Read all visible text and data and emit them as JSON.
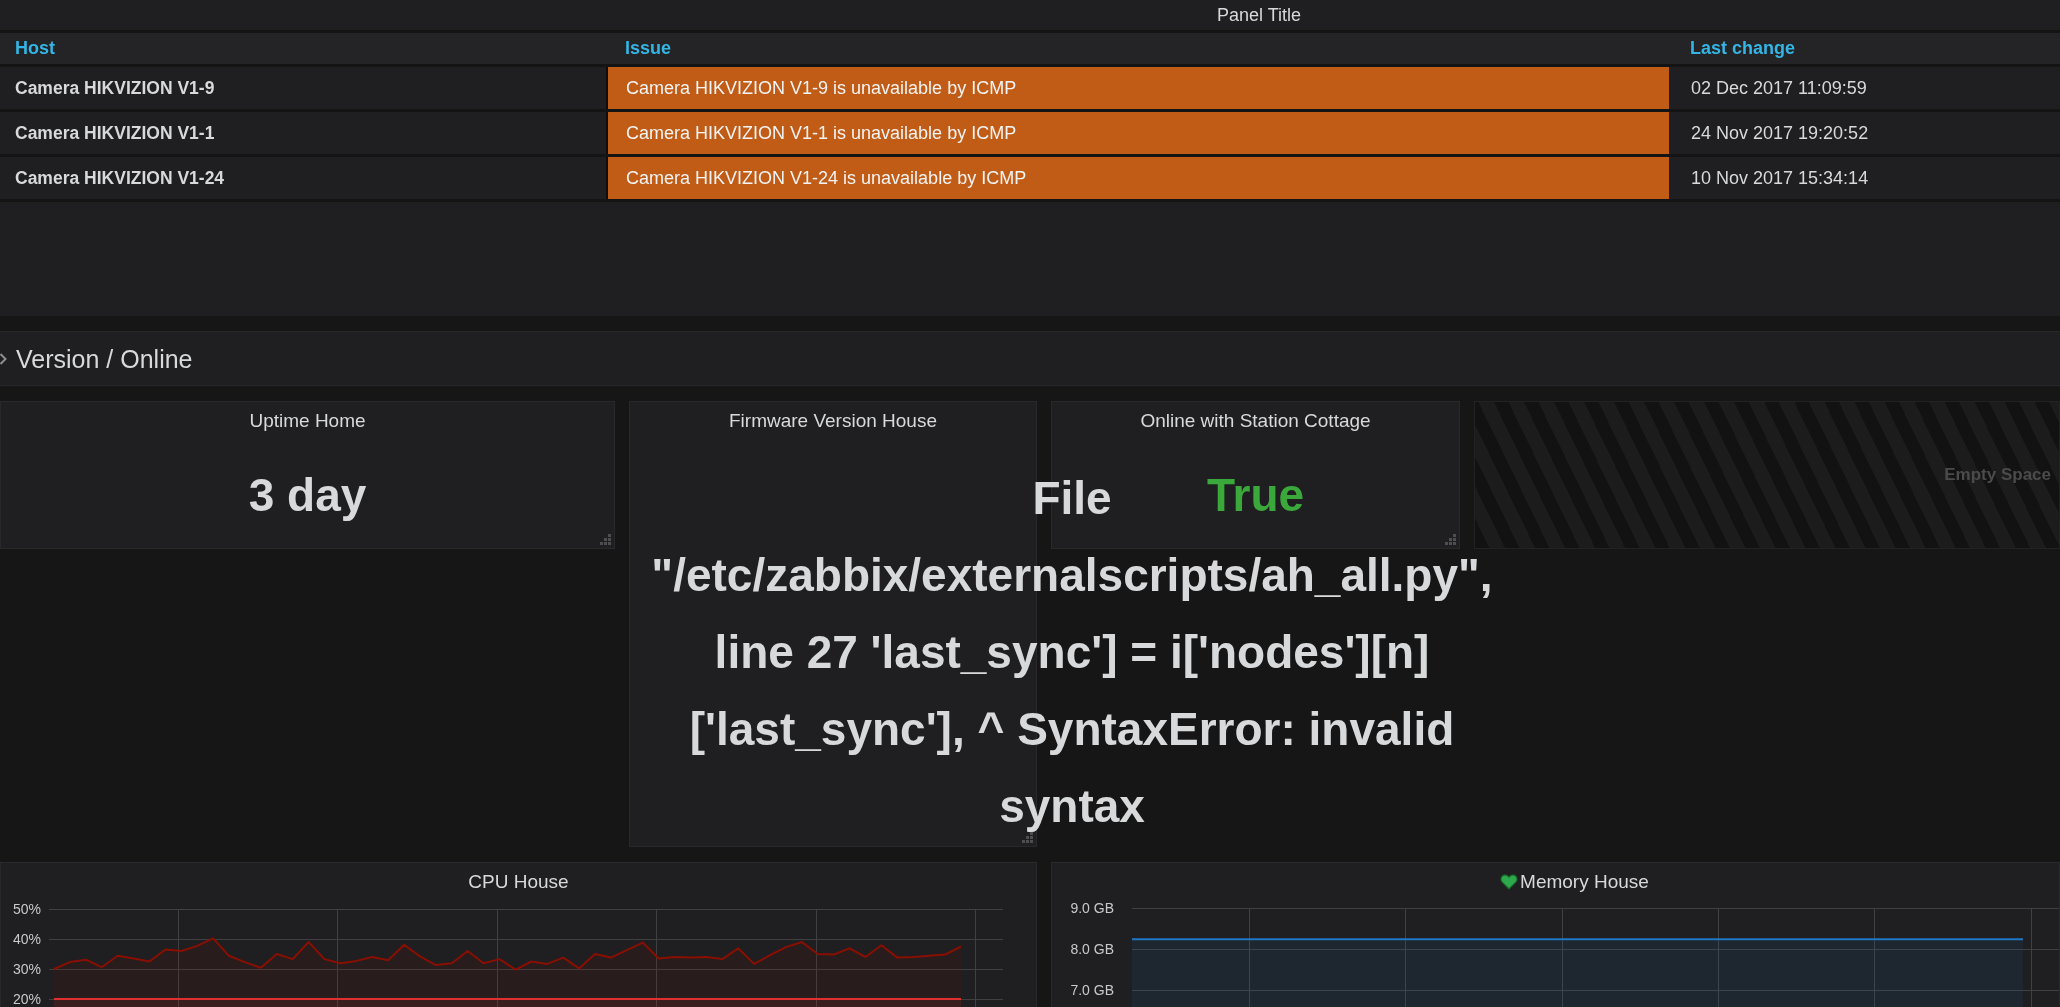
{
  "problems_panel": {
    "title": "Panel Title",
    "columns": [
      "Host",
      "Issue",
      "Last change"
    ],
    "rows": [
      {
        "host": "Camera HIKVIZION V1-9",
        "issue": "Camera HIKVIZION V1-9 is unavailable by ICMP",
        "color": "#c15c17",
        "last_change": "02 Dec 2017 11:09:59"
      },
      {
        "host": "Camera HIKVIZION V1-1",
        "issue": "Camera HIKVIZION V1-1 is unavailable by ICMP",
        "color": "#c15c17",
        "last_change": "24 Nov 2017 19:20:52"
      },
      {
        "host": "Camera HIKVIZION V1-24",
        "issue": "Camera HIKVIZION V1-24 is unavailable by ICMP",
        "color": "#c15c17",
        "last_change": "10 Nov 2017 15:34:14"
      }
    ]
  },
  "dashboard_row": {
    "title": "Version / Online"
  },
  "stat_panels": [
    {
      "kind": "stat",
      "title": "Uptime Home",
      "value": "3 day",
      "color": "#d8d9da"
    },
    {
      "kind": "stat",
      "title": "Firmware Version House",
      "value": "File \"/etc/zabbix/externalscripts/ah_all.py\", line 27 'last_sync'] = i['nodes'][n] ['last_sync'], ^ SyntaxError: invalid syntax",
      "color": "#d8d9da"
    },
    {
      "kind": "stat",
      "title": "Online with Station Cottage",
      "value": "True",
      "color": "#3aa83a"
    },
    {
      "kind": "placeholder",
      "label": "Empty Space"
    }
  ],
  "graph_panels": [
    {
      "title": "CPU House",
      "chart_data": {
        "type": "area",
        "ylim": [
          20,
          50
        ],
        "yticks": [
          {
            "value": 50,
            "label": "50%"
          },
          {
            "value": 40,
            "label": "40%"
          },
          {
            "value": 30,
            "label": "30%"
          },
          {
            "value": 20,
            "label": "20%"
          }
        ],
        "grid": true,
        "series": [
          {
            "color": "#890f02",
            "values": [
              30.0,
              32.3,
              33.1,
              30.6,
              34.4,
              33.5,
              32.5,
              36.5,
              36.0,
              37.7,
              40.2,
              34.4,
              32.3,
              30.4,
              35.0,
              33.3,
              39.0,
              33.3,
              31.9,
              32.7,
              34.0,
              32.9,
              38.1,
              34.2,
              31.3,
              31.9,
              36.0,
              31.9,
              33.3,
              29.8,
              32.5,
              31.7,
              33.8,
              30.2,
              35.0,
              33.8,
              36.3,
              38.8,
              33.5,
              34.0,
              33.8,
              34.0,
              33.3,
              36.9,
              31.7,
              34.6,
              37.3,
              39.0,
              35.0,
              34.8,
              36.9,
              34.0,
              37.9,
              33.8,
              34.0,
              34.4,
              34.8,
              37.5
            ]
          },
          {
            "color": "#e02f2f",
            "values": [
              20,
              20,
              20,
              20,
              20,
              20,
              20,
              20,
              20,
              20,
              20,
              20,
              20,
              20,
              20,
              20,
              20,
              20,
              20,
              20,
              20,
              20,
              20,
              20,
              20,
              20,
              20,
              20,
              20,
              20,
              20,
              20,
              20,
              20,
              20,
              20,
              20,
              20,
              20,
              20,
              20,
              20,
              20,
              20,
              20,
              20,
              20,
              20,
              20,
              20,
              20,
              20,
              20,
              20,
              20,
              20,
              20,
              20
            ]
          }
        ]
      }
    },
    {
      "title": "Memory House",
      "alerting": false,
      "chart_data": {
        "type": "area",
        "ylim": [
          7,
          9
        ],
        "yticks": [
          {
            "value": 9,
            "label": "9.0 GB"
          },
          {
            "value": 8,
            "label": "8.0 GB"
          },
          {
            "value": 7,
            "label": "7.0 GB"
          }
        ],
        "grid": true,
        "series": [
          {
            "color": "#1f78c1",
            "values": [
              8.24,
              8.24,
              8.24,
              8.24,
              8.24,
              8.24,
              8.24,
              8.24,
              8.24,
              8.24,
              8.24,
              8.24
            ]
          }
        ]
      }
    }
  ]
}
